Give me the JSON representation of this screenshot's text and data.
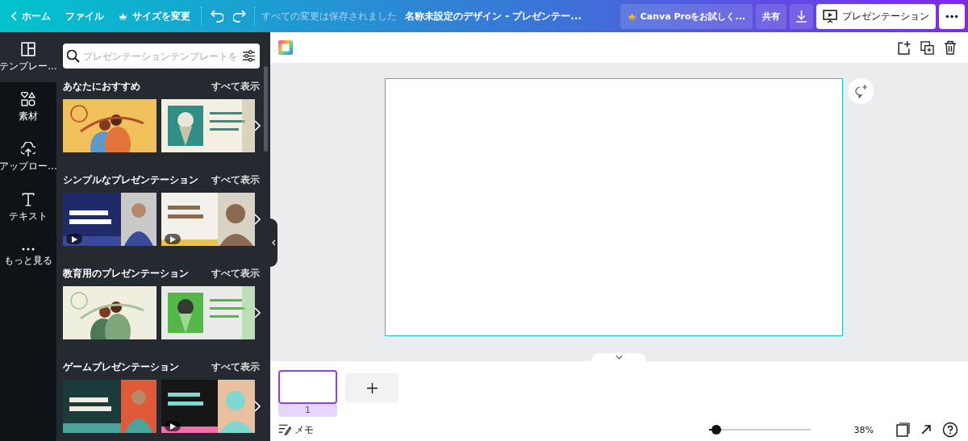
{
  "topbar": {
    "home": "ホーム",
    "file": "ファイル",
    "resize": "サイズを変更",
    "save_status": "すべての変更は保存されました",
    "title": "名称未設定のデザイン - プレゼンテー...",
    "pro": "Canva Proをお試しく...",
    "share": "共有",
    "present": "プレゼンテーション"
  },
  "rail": [
    {
      "label": "テンプレー...",
      "selected": true
    },
    {
      "label": "素材",
      "selected": false
    },
    {
      "label": "アップロー...",
      "selected": false
    },
    {
      "label": "テキスト",
      "selected": false
    },
    {
      "label": "もっと見る",
      "selected": false
    }
  ],
  "search": {
    "placeholder": "プレゼンテーションテンプレートを"
  },
  "sections": [
    {
      "title": "あなたにおすすめ",
      "link": "すべて表示",
      "templates": [
        {
          "kind": "picture",
          "video": false
        },
        {
          "kind": "picture",
          "video": false
        }
      ]
    },
    {
      "title": "シンプルなプレゼンテーション",
      "link": "すべて表示",
      "templates": [
        {
          "kind": "picture",
          "video": true
        },
        {
          "kind": "picture",
          "video": true
        }
      ]
    },
    {
      "title": "教育用のプレゼンテーション",
      "link": "すべて表示",
      "templates": [
        {
          "kind": "picture",
          "video": false
        },
        {
          "kind": "picture",
          "video": false
        }
      ]
    },
    {
      "title": "ゲームプレゼンテーション",
      "link": "すべて表示",
      "templates": [
        {
          "kind": "picture",
          "video": false
        },
        {
          "kind": "picture",
          "video": true
        }
      ]
    }
  ],
  "pages": [
    {
      "number": "1",
      "selected": true
    }
  ],
  "bottombar": {
    "notes": "メモ",
    "zoom": {
      "level": 0.03
    },
    "zoom_reading": "38%"
  }
}
